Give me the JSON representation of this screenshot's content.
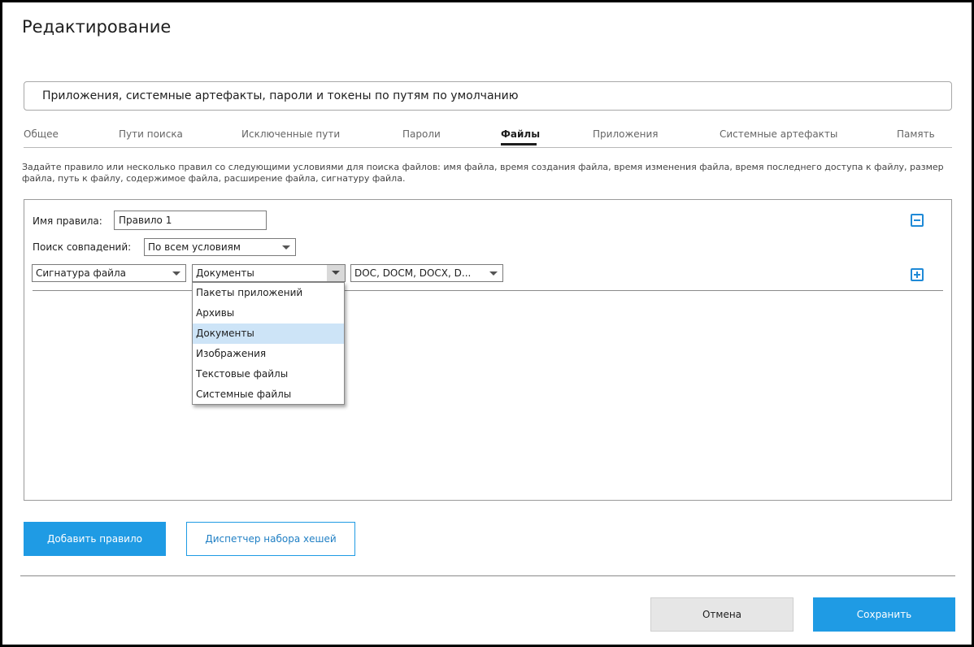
{
  "window": {
    "title": "Редактирование"
  },
  "profile": {
    "name_value": "Приложения, системные артефакты, пароли и токены по путям по умолчанию"
  },
  "tabs": [
    {
      "label": "Общее"
    },
    {
      "label": "Пути поиска"
    },
    {
      "label": "Исключенные пути"
    },
    {
      "label": "Пароли"
    },
    {
      "label": "Файлы"
    },
    {
      "label": "Приложения"
    },
    {
      "label": "Системные артефакты"
    },
    {
      "label": "Память"
    }
  ],
  "active_tab": "Файлы",
  "description": "Задайте правило или несколько правил со следующими условиями для поиска файлов: имя файла, время создания файла, время изменения файла, время последнего доступа к файлу, размер файла, путь к файлу, содержимое файла, расширение файла, сигнатуру файла.",
  "rule": {
    "name_label": "Имя правила:",
    "name_value": "Правило 1",
    "match_label": "Поиск совпадений:",
    "match_value": "По всем условиям",
    "condition": {
      "field_value": "Сигнатура файла",
      "category_value": "Документы",
      "extensions_value": "DOC, DOCM, DOCX, D..."
    },
    "remove_icon": "minus-square-icon",
    "add_icon": "plus-square-icon"
  },
  "category_dropdown": {
    "options": [
      "Пакеты приложений",
      "Архивы",
      "Документы",
      "Изображения",
      "Текстовые файлы",
      "Системные файлы"
    ],
    "selected": "Документы"
  },
  "buttons": {
    "add_rule": "Добавить правило",
    "hash_manager": "Диспетчер набора хешей",
    "cancel": "Отмена",
    "save": "Сохранить"
  },
  "colors": {
    "accent": "#1f9be4",
    "selection": "#cde4f7"
  }
}
